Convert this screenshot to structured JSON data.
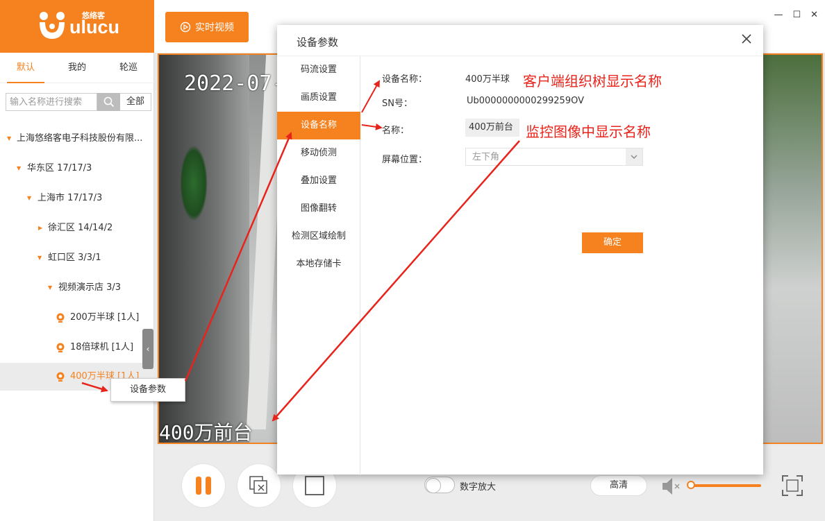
{
  "brand": {
    "logo_text": "ulucu",
    "logo_cn": "悠络客"
  },
  "sidebar": {
    "tabs": [
      {
        "label": "默认",
        "active": true
      },
      {
        "label": "我的",
        "active": false
      },
      {
        "label": "轮巡",
        "active": false
      }
    ],
    "search": {
      "placeholder": "输入名称进行搜索",
      "all_label": "全部"
    },
    "tree": [
      {
        "label": "上海悠络客电子科技股份有限...",
        "type": "group"
      },
      {
        "label": "华东区   17/17/3",
        "type": "group"
      },
      {
        "label": "上海市   17/17/3",
        "type": "group"
      },
      {
        "label": "徐汇区   14/14/2",
        "type": "group",
        "collapsed": true
      },
      {
        "label": "虹口区   3/3/1",
        "type": "group"
      },
      {
        "label": "视频演示店   3/3",
        "type": "group"
      },
      {
        "label": "200万半球  [1人]",
        "type": "camera"
      },
      {
        "label": "18倍球机  [1人]",
        "type": "camera"
      },
      {
        "label": "400万半球  [1人]",
        "type": "camera",
        "selected": true
      }
    ],
    "context_menu": {
      "label": "设备参数"
    }
  },
  "topbar": {
    "live_button": "实时视频"
  },
  "video": {
    "osd_time": "2022-07-",
    "osd_name": "400万前台"
  },
  "controls": {
    "digital_zoom_label": "数字放大",
    "quality_label": "高清",
    "volume_level": 0
  },
  "dialog": {
    "title": "设备参数",
    "menu": [
      {
        "label": "码流设置"
      },
      {
        "label": "画质设置"
      },
      {
        "label": "设备名称",
        "active": true
      },
      {
        "label": "移动侦测"
      },
      {
        "label": "叠加设置"
      },
      {
        "label": "图像翻转"
      },
      {
        "label": "检测区域绘制"
      },
      {
        "label": "本地存储卡"
      }
    ],
    "form": {
      "device_name_label": "设备名称：",
      "device_name_value": "400万半球",
      "sn_label": "SN号：",
      "sn_value": "Ub0000000000299259OV",
      "name_label": "名称：",
      "name_value": "400万前台",
      "position_label": "屏幕位置：",
      "position_value": "左下角"
    },
    "ok_label": "确定"
  },
  "annotations": {
    "client_tree_note": "客户端组织树显示名称",
    "osd_note": "监控图像中显示名称",
    "color": "#e8231b"
  },
  "colors": {
    "accent": "#f5821f"
  }
}
